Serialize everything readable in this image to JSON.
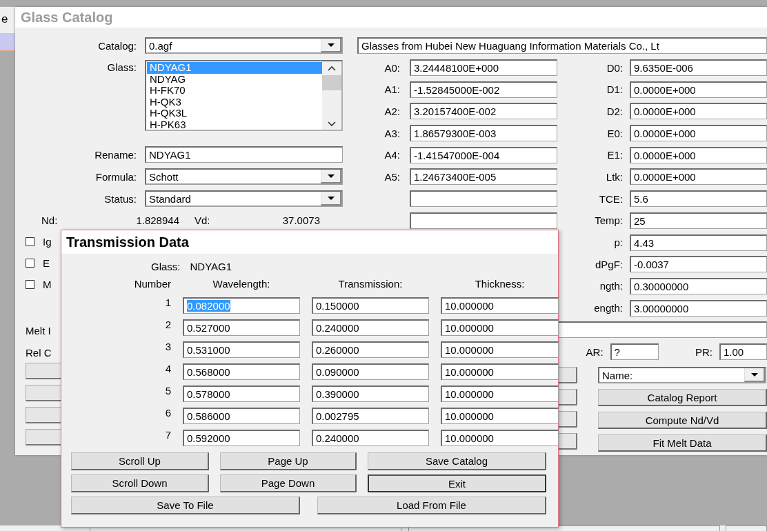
{
  "background_text": "e",
  "window": {
    "title": "Glass Catalog"
  },
  "catalog": {
    "label": "Catalog:",
    "value": "0.agf"
  },
  "glass": {
    "label": "Glass:",
    "items": [
      {
        "name": "NDYAG1",
        "selected": true
      },
      {
        "name": "NDYAG",
        "selected": false
      },
      {
        "name": "H-FK70",
        "selected": false
      },
      {
        "name": "H-QK3",
        "selected": false
      },
      {
        "name": "H-QK3L",
        "selected": false
      },
      {
        "name": "H-PK63",
        "selected": false
      }
    ]
  },
  "rename": {
    "label": "Rename:",
    "value": "NDYAG1"
  },
  "formula": {
    "label": "Formula:",
    "value": "Schott"
  },
  "status": {
    "label": "Status:",
    "value": "Standard"
  },
  "nd": {
    "label": "Nd:",
    "value": "1.828944"
  },
  "vd": {
    "label": "Vd:",
    "value": "37.0073"
  },
  "checkboxes": [
    {
      "label": "Ig",
      "checked": false
    },
    {
      "label": "E",
      "checked": false
    },
    {
      "label": "M",
      "checked": false
    }
  ],
  "left_labels": [
    "Melt I",
    "Rel C"
  ],
  "description": "Glasses from Hubei New Huaguang Information Materials Co., Lt",
  "coefficients_a": [
    {
      "label": "A0:",
      "value": "3.24448100E+000"
    },
    {
      "label": "A1:",
      "value": "-1.52845000E-002"
    },
    {
      "label": "A2:",
      "value": "3.20157400E-002"
    },
    {
      "label": "A3:",
      "value": "1.86579300E-003"
    },
    {
      "label": "A4:",
      "value": "-1.41547000E-004"
    },
    {
      "label": "A5:",
      "value": "1.24673400E-005"
    }
  ],
  "coefficients_d": [
    {
      "label": "D0:",
      "value": "9.6350E-006"
    },
    {
      "label": "D1:",
      "value": "0.0000E+000"
    },
    {
      "label": "D2:",
      "value": "0.0000E+000"
    },
    {
      "label": "E0:",
      "value": "0.0000E+000"
    },
    {
      "label": "E1:",
      "value": "0.0000E+000"
    },
    {
      "label": "Ltk:",
      "value": "0.0000E+000"
    },
    {
      "label": "TCE:",
      "value": "5.6"
    },
    {
      "label": "Temp:",
      "value": "25"
    },
    {
      "label": "p:",
      "value": "4.43"
    },
    {
      "label": "dPgF:",
      "value": "-0.0037"
    },
    {
      "label": "ngth:",
      "value": "0.30000000"
    },
    {
      "label": "ength:",
      "value": "3.00000000"
    }
  ],
  "ar": {
    "label": "AR:",
    "value": "?"
  },
  "pr": {
    "label": "PR:",
    "value": "1.00"
  },
  "sort": {
    "value": "Name:"
  },
  "buttons": [
    "Catalog Report",
    "Compute Nd/Vd",
    "Fit Melt Data"
  ],
  "dialog": {
    "title": "Transmission Data",
    "glass_label": "Glass:",
    "glass": "NDYAG1",
    "columns": [
      "Number",
      "Wavelength:",
      "Transmission:",
      "Thickness:"
    ],
    "rows": [
      {
        "number": "1",
        "wavelength": "0.082000",
        "transmission": "0.150000",
        "thickness": "10.000000",
        "selected": true
      },
      {
        "number": "2",
        "wavelength": "0.527000",
        "transmission": "0.240000",
        "thickness": "10.000000",
        "selected": false
      },
      {
        "number": "3",
        "wavelength": "0.531000",
        "transmission": "0.260000",
        "thickness": "10.000000",
        "selected": false
      },
      {
        "number": "4",
        "wavelength": "0.568000",
        "transmission": "0.090000",
        "thickness": "10.000000",
        "selected": false
      },
      {
        "number": "5",
        "wavelength": "0.578000",
        "transmission": "0.390000",
        "thickness": "10.000000",
        "selected": false
      },
      {
        "number": "6",
        "wavelength": "0.586000",
        "transmission": "0.002795",
        "thickness": "10.000000",
        "selected": false
      },
      {
        "number": "7",
        "wavelength": "0.592000",
        "transmission": "0.240000",
        "thickness": "10.000000",
        "selected": false
      }
    ],
    "buttons": [
      {
        "label": "Scroll Up",
        "default": false
      },
      {
        "label": "Page Up",
        "default": false
      },
      {
        "label": "Save Catalog",
        "default": false
      },
      {
        "label": "Scroll Down",
        "default": false
      },
      {
        "label": "Page Down",
        "default": false
      },
      {
        "label": "Exit",
        "default": true
      },
      {
        "label": "Save To File",
        "default": false
      },
      {
        "label": "Load From File",
        "default": false
      }
    ]
  }
}
